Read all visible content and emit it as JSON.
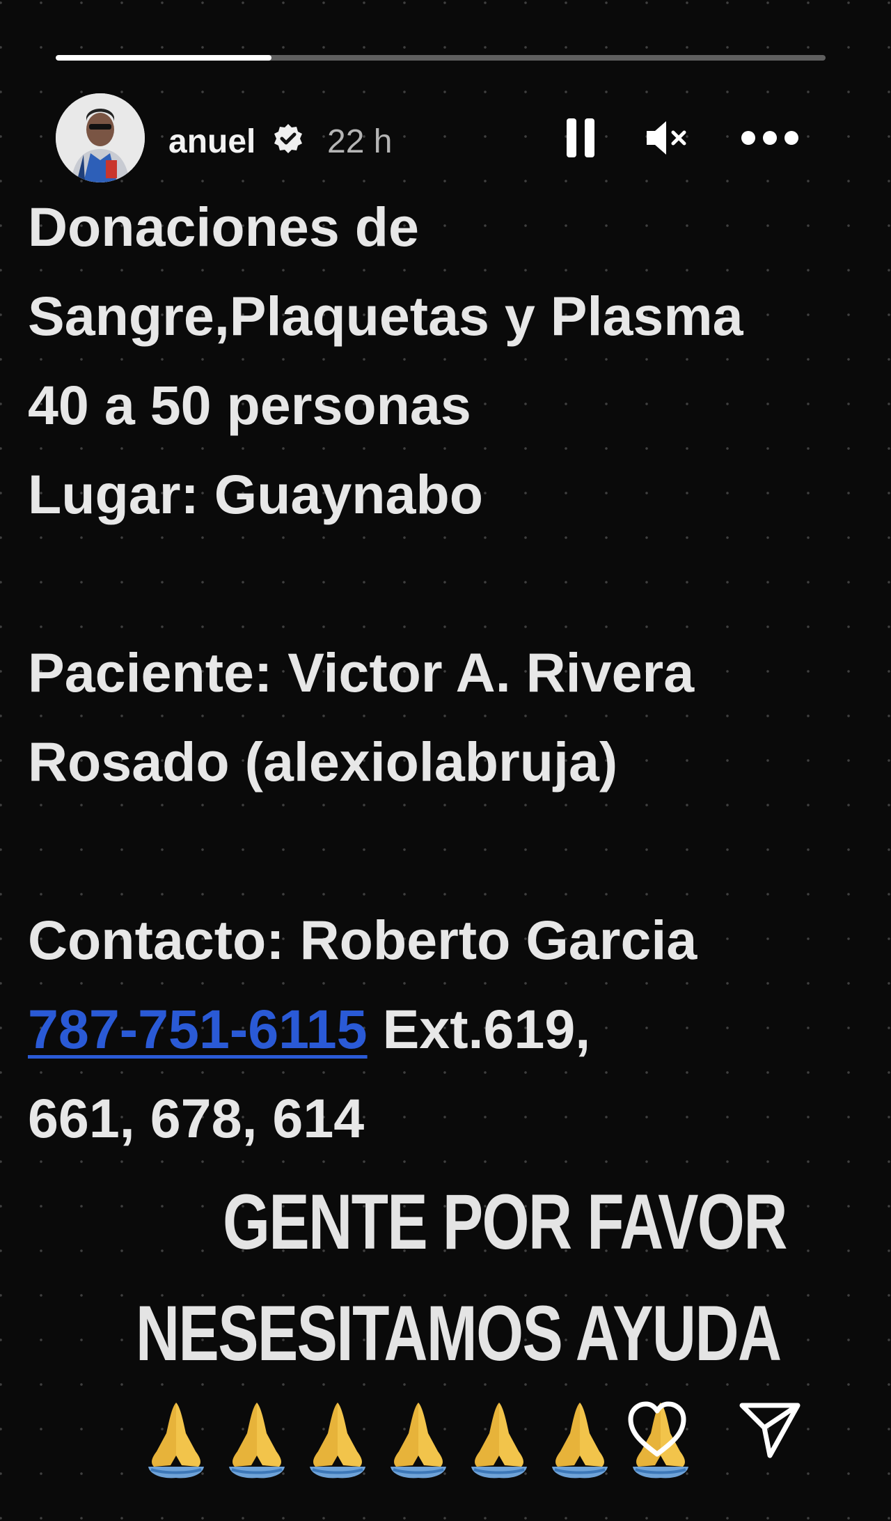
{
  "progress": {
    "fraction": 0.28
  },
  "header": {
    "username": "anuel",
    "time": "22 h",
    "verified_icon": "verified-badge-icon",
    "controls": [
      "pause-icon",
      "mute-icon",
      "more-icon"
    ]
  },
  "story": {
    "lines": {
      "l1": "Donaciones de",
      "l2": "Sangre,Plaquetas y Plasma",
      "l3": "40 a 50 personas",
      "l4": "Lugar: Guaynabo",
      "l5": "Paciente: Victor A. Rivera",
      "l6": "Rosado (alexiolabruja)",
      "l7": "Contacto: Roberto Garcia",
      "phone": "787-751-6115",
      "ext": " Ext.619,",
      "l9": "661, 678, 614"
    },
    "caption1": "GENTE POR FAVOR",
    "caption2": "NESESITAMOS AYUDA",
    "emoji": "🙏🙏🙏🙏🙏🙏🙏",
    "link_color": "#2a5ad6"
  },
  "actions": {
    "like_icon": "heart-icon",
    "share_icon": "send-icon"
  }
}
